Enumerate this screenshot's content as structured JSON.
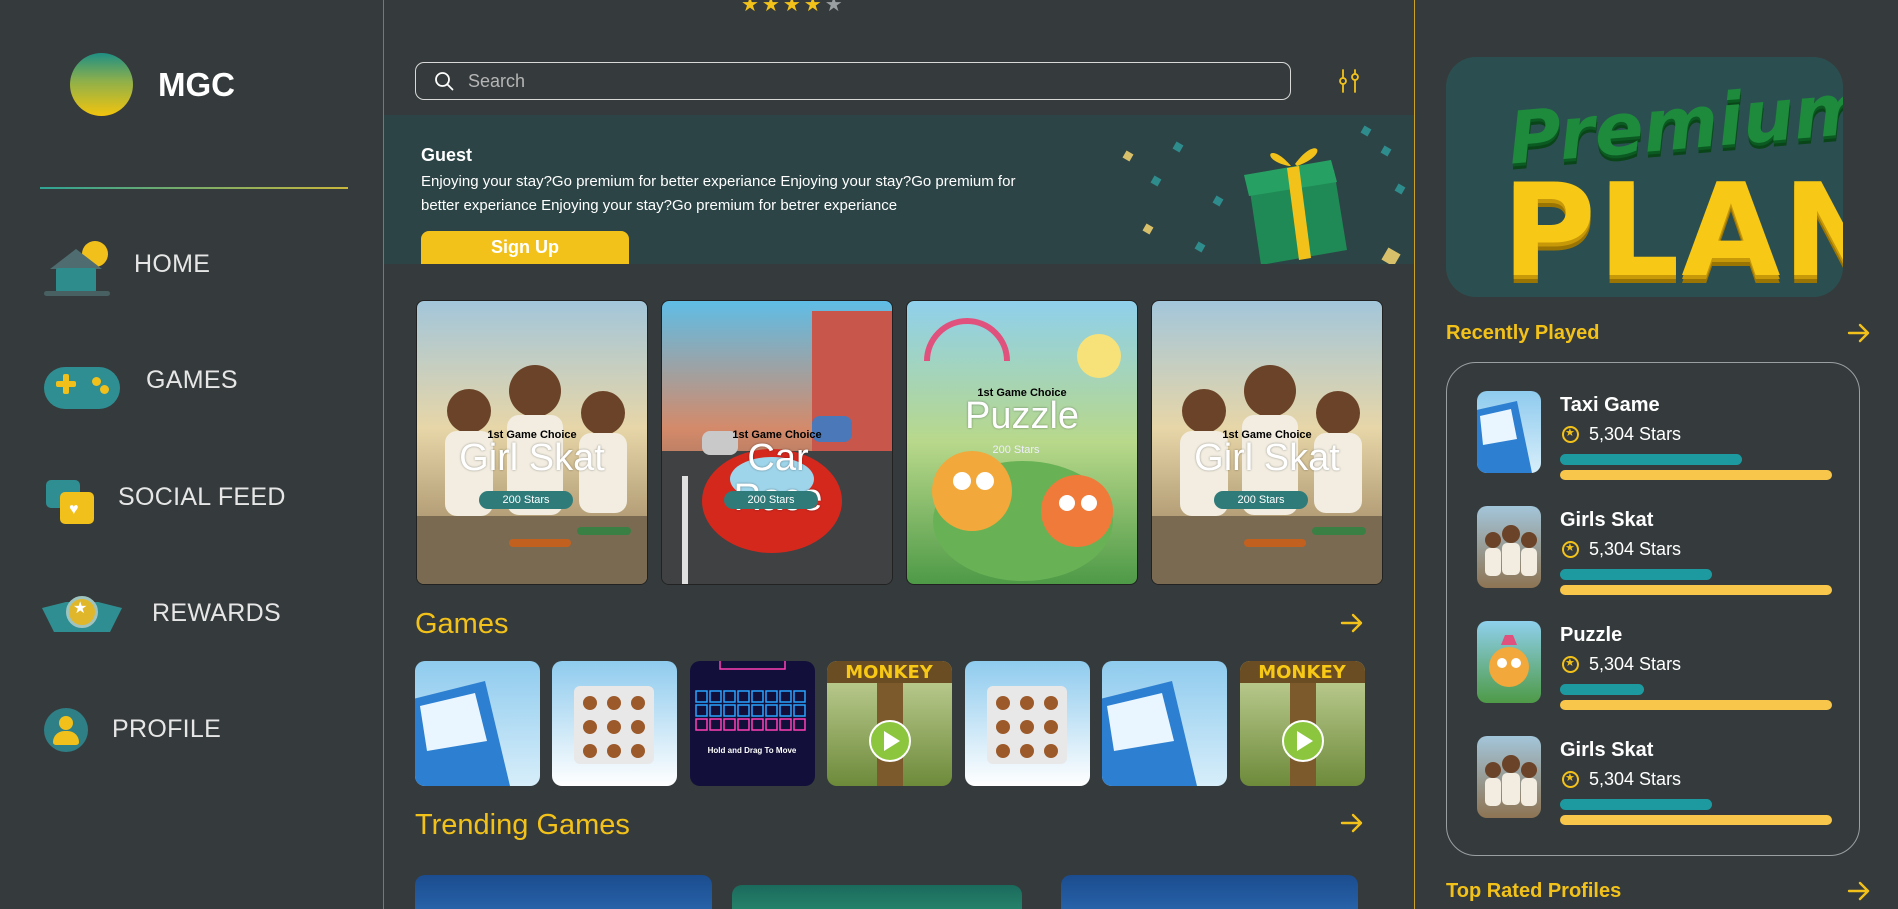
{
  "brand": {
    "name": "MGC"
  },
  "nav": [
    {
      "label": "HOME",
      "icon": "home-icon"
    },
    {
      "label": "GAMES",
      "icon": "gamepad-icon"
    },
    {
      "label": "SOCIAL FEED",
      "icon": "chat-bubbles-icon"
    },
    {
      "label": "REWARDS",
      "icon": "medal-icon"
    },
    {
      "label": "PROFILE",
      "icon": "user-icon"
    }
  ],
  "search": {
    "placeholder": "Search"
  },
  "banner": {
    "title": "Guest",
    "text": "Enjoying your stay?Go premium for better experiance Enjoying your stay?Go premium for better experiance Enjoying your stay?Go premium for betrer experiance",
    "button": "Sign Up"
  },
  "featured": [
    {
      "choice": "1st Game Choice",
      "title": "Girl Skat",
      "badge": "200 Stars"
    },
    {
      "choice": "1st Game Choice",
      "title": "Car Race",
      "badge": "200 Stars"
    },
    {
      "choice": "1st Game Choice",
      "title": "Puzzle",
      "badge": "200 Stars"
    },
    {
      "choice": "1st Game Choice",
      "title": "Girl Skat",
      "badge": "200 Stars"
    }
  ],
  "sections": {
    "games": "Games",
    "trending": "Trending Games"
  },
  "games_tiles": [
    {
      "name": "taxi",
      "caption": ""
    },
    {
      "name": "mahjong",
      "caption": ""
    },
    {
      "name": "neon-blocks",
      "caption": "Hold and Drag To Move"
    },
    {
      "name": "monkey",
      "caption": "MONKEY"
    },
    {
      "name": "mahjong",
      "caption": ""
    },
    {
      "name": "taxi",
      "caption": ""
    },
    {
      "name": "monkey",
      "caption": "MONKEY"
    }
  ],
  "premium": {
    "line1": "Premium",
    "line2": "PLAN"
  },
  "recently_played": {
    "title": "Recently Played",
    "items": [
      {
        "name": "Taxi Game",
        "stars": "5,304 Stars",
        "progress": 0.67
      },
      {
        "name": "Girls Skat",
        "stars": "5,304 Stars",
        "progress": 0.56
      },
      {
        "name": "Puzzle",
        "stars": "5,304 Stars",
        "progress": 0.31
      },
      {
        "name": "Girls Skat",
        "stars": "5,304 Stars",
        "progress": 0.56
      }
    ]
  },
  "top_rated": {
    "title": "Top Rated Profiles"
  },
  "rating": {
    "value": 4,
    "max": 5
  },
  "colors": {
    "accent": "#f3c21a",
    "teal": "#1d9aa0",
    "background": "#353b3c"
  }
}
